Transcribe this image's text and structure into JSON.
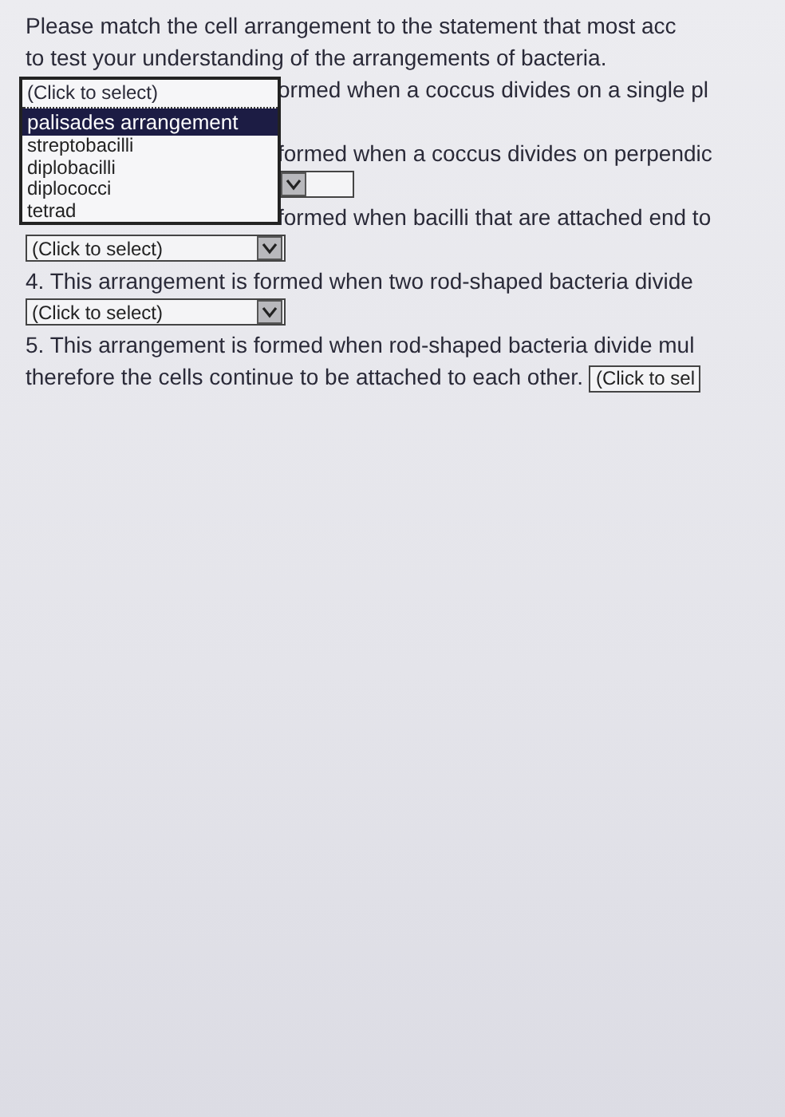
{
  "intro": [
    "Please match the cell arrangement to the statement that most acc",
    "to test your understanding of the arrangements of bacteria."
  ],
  "open_dropdown": {
    "value": "(Click to select)",
    "options": [
      {
        "label": "palisades arrangement",
        "selected": true
      },
      {
        "label": "streptobacilli",
        "selected": false
      },
      {
        "label": "diplobacilli",
        "selected": false
      },
      {
        "label": "diplococci",
        "selected": false
      },
      {
        "label": "tetrad",
        "selected": false
      }
    ]
  },
  "statements": [
    {
      "kind": "covered",
      "lines": [
        "ormed when a coccus divides on a single pl"
      ]
    },
    {
      "kind": "covered",
      "lines": [
        "formed when a coccus divides on perpendic"
      ],
      "select": {
        "kind": "arrow-only"
      }
    },
    {
      "kind": "covered",
      "lines": [
        "formed when bacilli that are attached end to"
      ],
      "select": {
        "value": "(Click to select)"
      }
    },
    {
      "kind": "plain",
      "lines": [
        "4. This arrangement is formed when two rod-shaped bacteria divide"
      ],
      "select": {
        "value": "(Click to select)"
      }
    },
    {
      "kind": "inline",
      "lines": [
        "5. This arrangement is formed when rod-shaped bacteria divide mul",
        "therefore the cells continue to be attached to each other."
      ],
      "select": {
        "value": "(Click to sel"
      }
    }
  ]
}
